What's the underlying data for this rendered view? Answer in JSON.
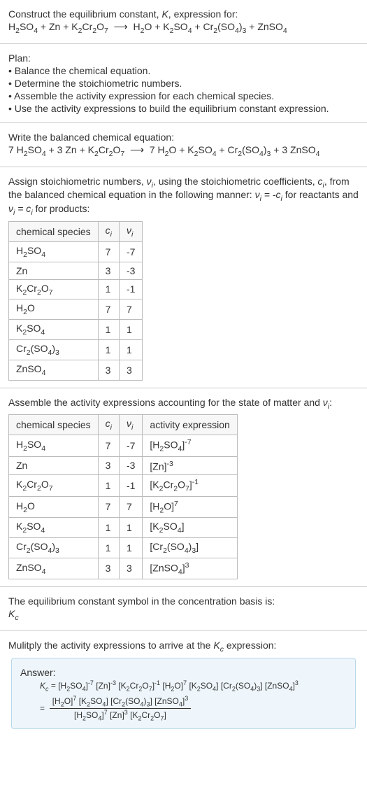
{
  "s1": {
    "title_pre": "Construct the equilibrium constant, ",
    "title_k": "K",
    "title_post": ", expression for:"
  },
  "s2": {
    "title": "Plan:",
    "b1": "• Balance the chemical equation.",
    "b2": "• Determine the stoichiometric numbers.",
    "b3": "• Assemble the activity expression for each chemical species.",
    "b4": "• Use the activity expressions to build the equilibrium constant expression."
  },
  "s3": {
    "title": "Write the balanced chemical equation:"
  },
  "s4": {
    "p1a": "Assign stoichiometric numbers, ",
    "p1b": ", using the stoichiometric coefficients, ",
    "p1c": ", from the balanced chemical equation in the following manner: ",
    "p1d": " for reactants and ",
    "p1e": " for products:",
    "h1": "chemical species",
    "rows": [
      {
        "c": "7",
        "v": "-7"
      },
      {
        "c": "3",
        "v": "-3"
      },
      {
        "c": "1",
        "v": "-1"
      },
      {
        "c": "7",
        "v": "7"
      },
      {
        "c": "1",
        "v": "1"
      },
      {
        "c": "1",
        "v": "1"
      },
      {
        "c": "3",
        "v": "3"
      }
    ]
  },
  "s5": {
    "p1a": "Assemble the activity expressions accounting for the state of matter and ",
    "p1b": ":",
    "h1": "chemical species",
    "h4": "activity expression",
    "rows": [
      {
        "c": "7",
        "v": "-7"
      },
      {
        "c": "3",
        "v": "-3"
      },
      {
        "c": "1",
        "v": "-1"
      },
      {
        "c": "7",
        "v": "7"
      },
      {
        "c": "1",
        "v": "1"
      },
      {
        "c": "1",
        "v": "1"
      },
      {
        "c": "3",
        "v": "3"
      }
    ]
  },
  "s6": {
    "p1": "The equilibrium constant symbol in the concentration basis is:"
  },
  "s7": {
    "p1a": "Mulitply the activity expressions to arrive at the ",
    "p1b": " expression:",
    "ans": "Answer:"
  },
  "chart_data": {
    "type": "table",
    "reaction_unbalanced": "H2SO4 + Zn + K2Cr2O7 -> H2O + K2SO4 + Cr2(SO4)3 + ZnSO4",
    "reaction_balanced": "7 H2SO4 + 3 Zn + K2Cr2O7 -> 7 H2O + K2SO4 + Cr2(SO4)3 + 3 ZnSO4",
    "stoichiometry": [
      {
        "species": "H2SO4",
        "c_i": 7,
        "v_i": -7
      },
      {
        "species": "Zn",
        "c_i": 3,
        "v_i": -3
      },
      {
        "species": "K2Cr2O7",
        "c_i": 1,
        "v_i": -1
      },
      {
        "species": "H2O",
        "c_i": 7,
        "v_i": 7
      },
      {
        "species": "K2SO4",
        "c_i": 1,
        "v_i": 1
      },
      {
        "species": "Cr2(SO4)3",
        "c_i": 1,
        "v_i": 1
      },
      {
        "species": "ZnSO4",
        "c_i": 3,
        "v_i": 3
      }
    ],
    "activity_expressions": [
      {
        "species": "H2SO4",
        "expr": "[H2SO4]^-7"
      },
      {
        "species": "Zn",
        "expr": "[Zn]^-3"
      },
      {
        "species": "K2Cr2O7",
        "expr": "[K2Cr2O7]^-1"
      },
      {
        "species": "H2O",
        "expr": "[H2O]^7"
      },
      {
        "species": "K2SO4",
        "expr": "[K2SO4]"
      },
      {
        "species": "Cr2(SO4)3",
        "expr": "[Cr2(SO4)3]"
      },
      {
        "species": "ZnSO4",
        "expr": "[ZnSO4]^3"
      }
    ],
    "Kc_product": "[H2SO4]^-7 [Zn]^-3 [K2Cr2O7]^-1 [H2O]^7 [K2SO4] [Cr2(SO4)3] [ZnSO4]^3",
    "Kc_fraction": "([H2O]^7 [K2SO4] [Cr2(SO4)3] [ZnSO4]^3) / ([H2SO4]^7 [Zn]^3 [K2Cr2O7])"
  }
}
